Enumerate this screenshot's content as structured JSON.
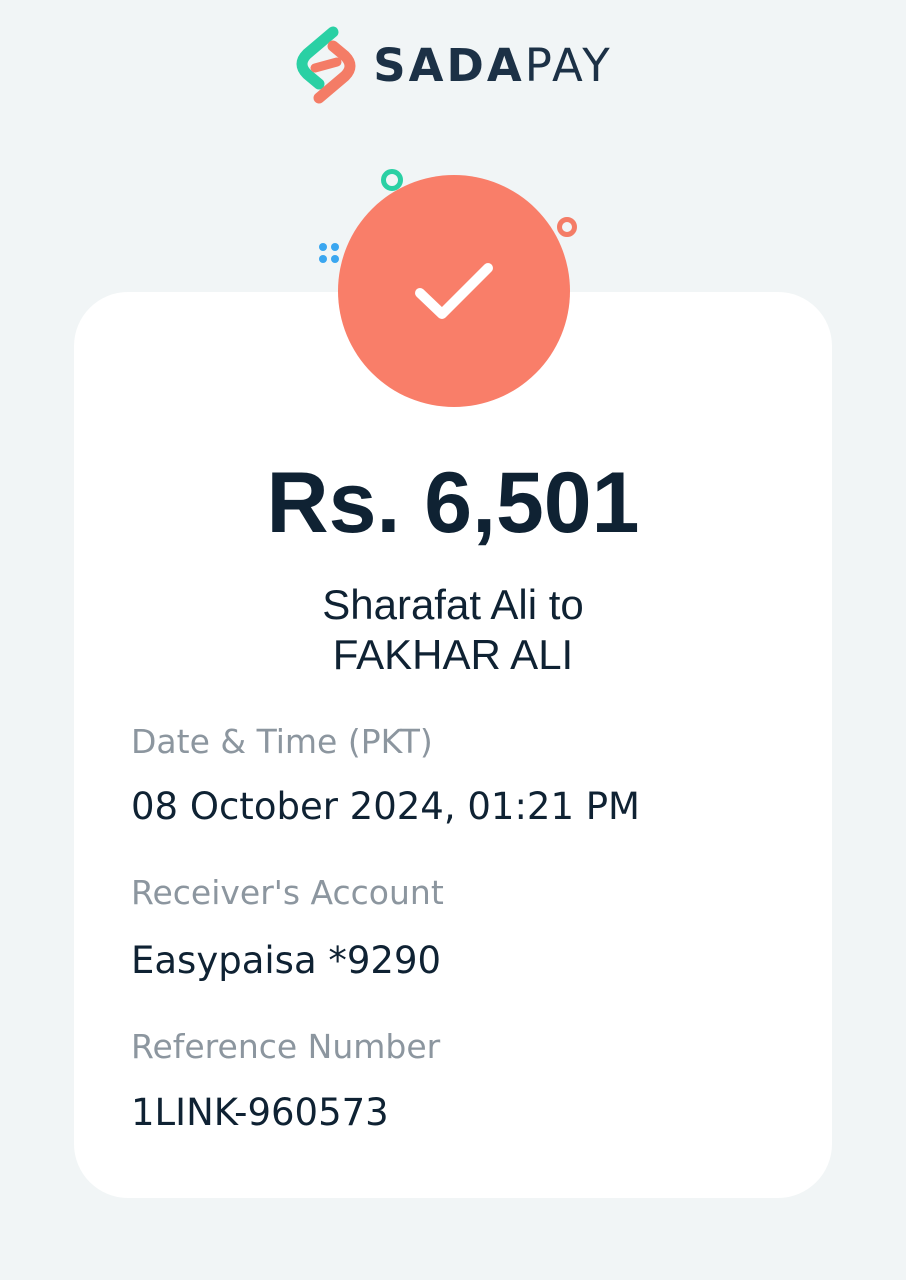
{
  "brand": {
    "name_part1": "SADA",
    "name_part2": "PAY",
    "logo_icon": "sadapay-logo-icon"
  },
  "colors": {
    "page_background": "#f1f5f6",
    "card_background": "#ffffff",
    "accent_coral": "#f97e69",
    "accent_teal": "#2ad0a4",
    "accent_blue": "#3aa6f0",
    "text_primary": "#0f2233",
    "text_muted": "#8c969f"
  },
  "status": {
    "icon": "check-icon"
  },
  "transaction": {
    "amount": "Rs. 6,501",
    "sender": "Sharafat Ali",
    "connector": "to",
    "receiver": "FAKHAR ALI"
  },
  "details": [
    {
      "label": "Date & Time (PKT)",
      "value": "08 October 2024, 01:21 PM"
    },
    {
      "label": "Receiver's Account",
      "value": "Easypaisa *9290"
    },
    {
      "label": "Reference Number",
      "value": "1LINK-960573"
    }
  ]
}
